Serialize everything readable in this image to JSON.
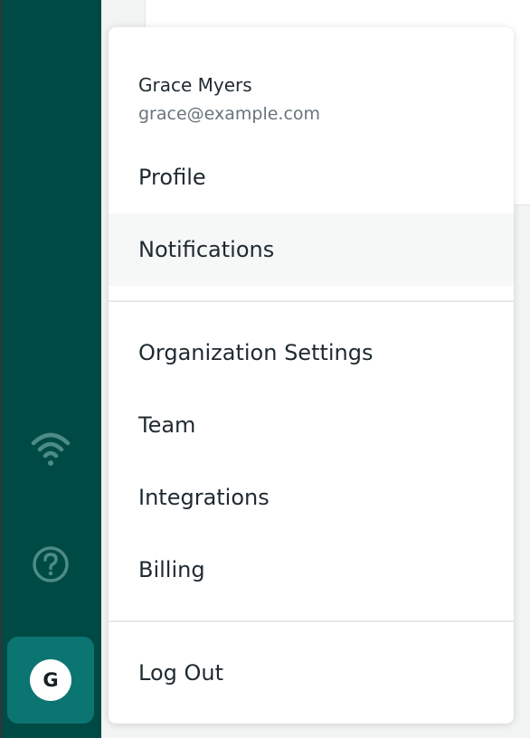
{
  "sidebar": {
    "icons": [
      "wifi-icon",
      "help-circle-icon"
    ],
    "avatar_initial": "G"
  },
  "user_menu": {
    "name": "Grace Myers",
    "email": "grace@example.com",
    "items_group1": [
      "Profile",
      "Notifications"
    ],
    "items_group2": [
      "Organization Settings",
      "Team",
      "Integrations",
      "Billing"
    ],
    "logout_label": "Log Out",
    "highlighted_item": "Notifications"
  },
  "colors": {
    "sidebar": "#004a45",
    "avatar_tile": "#0b7572",
    "menu_background": "#ffffff",
    "hover_background": "#f6f7f7",
    "text": "#1f2a30",
    "muted_text": "#68747b"
  }
}
